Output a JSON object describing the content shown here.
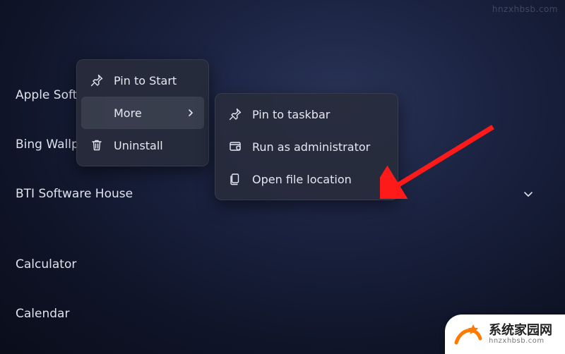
{
  "apps": {
    "item0": "Apple Soft",
    "item1": "Bing Wallp",
    "item2": "BTI Software House",
    "item3": "Calculator",
    "item4": "Calendar"
  },
  "menu1": {
    "pin_to_start": "Pin to Start",
    "more": "More",
    "uninstall": "Uninstall"
  },
  "menu2": {
    "pin_to_taskbar": "Pin to taskbar",
    "run_as_admin": "Run as administrator",
    "open_file_location": "Open file location"
  },
  "watermark": {
    "top": "hnzxhbsb.com",
    "logo_big": "系统家园网",
    "logo_small": "hnzxhbsb.com"
  }
}
